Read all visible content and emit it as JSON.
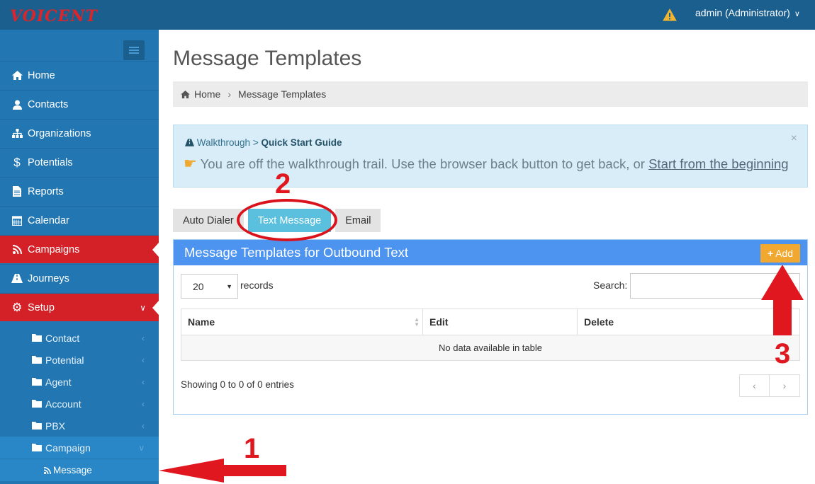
{
  "app": {
    "logo": "VOICENT"
  },
  "header": {
    "user": "admin (Administrator)"
  },
  "sidebar": {
    "items": [
      {
        "label": "Home"
      },
      {
        "label": "Contacts"
      },
      {
        "label": "Organizations"
      },
      {
        "label": "Potentials"
      },
      {
        "label": "Reports"
      },
      {
        "label": "Calendar"
      },
      {
        "label": "Campaigns"
      },
      {
        "label": "Journeys"
      },
      {
        "label": "Setup"
      }
    ],
    "setup_items": [
      {
        "label": "Contact"
      },
      {
        "label": "Potential"
      },
      {
        "label": "Agent"
      },
      {
        "label": "Account"
      },
      {
        "label": "PBX"
      },
      {
        "label": "Campaign"
      },
      {
        "label": "Message"
      }
    ]
  },
  "main": {
    "title": "Message Templates",
    "breadcrumb": {
      "home": "Home",
      "current": "Message Templates"
    },
    "alert": {
      "walkthrough": "Walkthrough",
      "sep": ">",
      "guide": "Quick Start Guide",
      "message": "You are off the walkthrough trail. Use the browser back button to get back, or",
      "link": "Start from the beginning",
      "close": "×"
    },
    "tabs": [
      {
        "label": "Auto Dialer"
      },
      {
        "label": "Text Message"
      },
      {
        "label": "Email"
      }
    ],
    "panel": {
      "title": "Message Templates for Outbound Text",
      "add_label": "Add",
      "page_length": "20",
      "records_label": "records",
      "search_label": "Search:",
      "columns": [
        "Name",
        "Edit",
        "Delete"
      ],
      "empty": "No data available in table",
      "info": "Showing 0 to 0 of 0 entries",
      "prev": "‹",
      "next": "›"
    }
  },
  "annotations": {
    "one": "1",
    "two": "2",
    "three": "3"
  },
  "colors": {
    "topbar": "#1a5f8e",
    "sidebar": "#2277b3",
    "active": "#d42027",
    "panel_header": "#4d94f0",
    "add_button": "#f0a830",
    "tab_selected": "#5bc0de",
    "annotation": "#e0171f"
  }
}
